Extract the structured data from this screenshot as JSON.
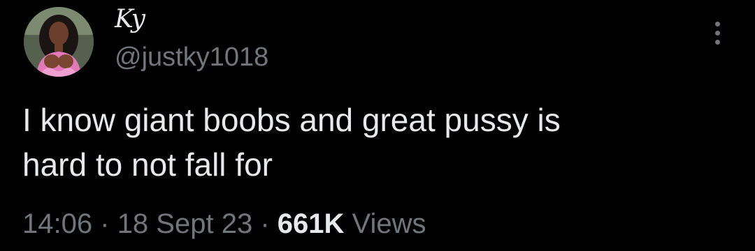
{
  "author": {
    "display_name": "Ky",
    "handle": "@justky1018"
  },
  "more_icon": "more-vertical-icon",
  "tweet": {
    "text": "I know giant boobs and great pussy is\nhard to not fall for"
  },
  "meta": {
    "time": "14:06",
    "separator": "·",
    "date": "18 Sept 23",
    "views_count": "661K",
    "views_label": "Views"
  },
  "colors": {
    "background": "#000000",
    "primary_text": "#e7e9ea",
    "secondary_text": "#71767b"
  }
}
